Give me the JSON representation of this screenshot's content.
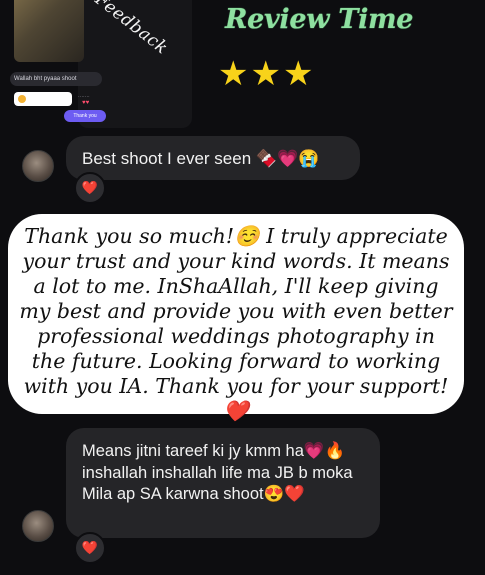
{
  "preview": {
    "title": "Feedback",
    "caption": "Wallah bht pyaaa shoot",
    "bubble": "Thank you"
  },
  "header": {
    "title": "Review Time",
    "stars": "★★★",
    "star_count": 3,
    "title_color": "#8ee0a0",
    "star_color": "#f8d31a"
  },
  "messages": [
    {
      "text": "Best shoot I ever seen 🍫💗😭",
      "reaction": "❤️"
    },
    {
      "text": "Means jitni tareef ki jy kmm ha💗🔥 inshallah inshallah life ma JB b moka Mila ap SA karwna shoot😍❤️",
      "reaction": "❤️"
    }
  ],
  "reply": {
    "text": "Thank you so much!☺️ I truly appreciate your trust and your kind words. It means a lot to me. InShaAllah, I'll keep giving my best and provide you with even better professional weddings photography in the future. Looking forward to working with you IA. Thank you for your support!❤️"
  },
  "colors": {
    "background": "#0d0d10",
    "incoming_bubble": "#252528",
    "reply_bubble": "#ffffff",
    "accent_purple": "#6d5cf2"
  }
}
